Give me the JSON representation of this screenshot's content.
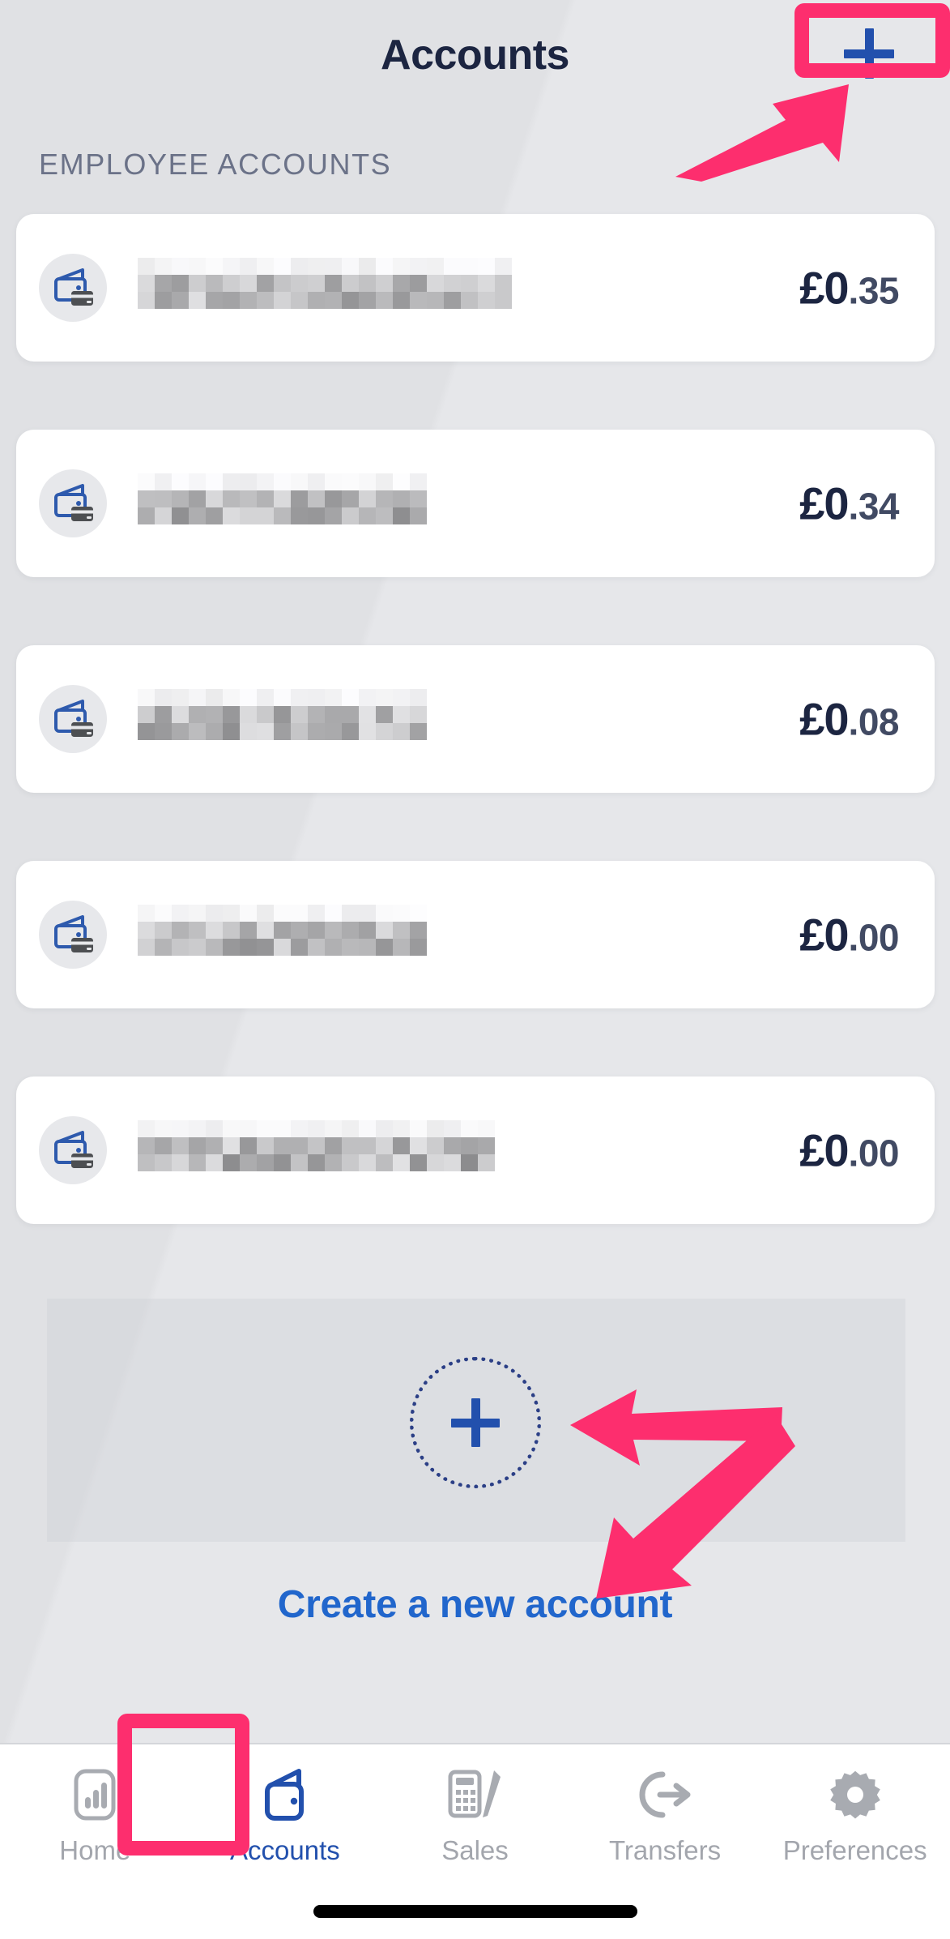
{
  "header": {
    "title": "Accounts",
    "add_button_icon": "plus-icon"
  },
  "section": {
    "label": "EMPLOYEE ACCOUNTS"
  },
  "accounts": [
    {
      "name_redacted": true,
      "icon": "wallet-card-icon",
      "currency": "£",
      "major": "0",
      "minor": ".35",
      "blur_width": 470,
      "blur_offset": 0
    },
    {
      "name_redacted": true,
      "icon": "wallet-card-icon",
      "currency": "£",
      "major": "0",
      "minor": ".34",
      "blur_width": 360,
      "blur_offset": 0
    },
    {
      "name_redacted": true,
      "icon": "wallet-card-icon",
      "currency": "£",
      "major": "0",
      "minor": ".08",
      "blur_width": 353,
      "blur_offset": 0
    },
    {
      "name_redacted": true,
      "icon": "wallet-card-icon",
      "currency": "£",
      "major": "0",
      "minor": ".00",
      "blur_width": 347,
      "blur_offset": 0
    },
    {
      "name_redacted": true,
      "icon": "wallet-card-icon",
      "currency": "£",
      "major": "0",
      "minor": ".00",
      "blur_width": 450,
      "blur_offset": 0
    }
  ],
  "create_account": {
    "label": "Create a new account",
    "plus_icon": "plus-icon"
  },
  "tabbar": {
    "items": [
      {
        "label": "Home",
        "icon": "bar-chart-icon",
        "active": false
      },
      {
        "label": "Accounts",
        "icon": "wallet-icon",
        "active": true
      },
      {
        "label": "Sales",
        "icon": "calculator-pen-icon",
        "active": false
      },
      {
        "label": "Transfers",
        "icon": "transfer-arrow-icon",
        "active": false
      },
      {
        "label": "Preferences",
        "icon": "gear-icon",
        "active": false
      }
    ]
  },
  "annotations": {
    "highlight_color": "#fd2e6e",
    "targets": [
      "add-account-button",
      "create-a-new-account",
      "accounts-tab"
    ]
  },
  "colors": {
    "accent_blue": "#2250ad",
    "link_blue": "#2166cc",
    "balance_dark": "#1c2541",
    "background": "#e2e3e6",
    "card": "#ffffff",
    "annotation_pink": "#fd2e6e"
  }
}
